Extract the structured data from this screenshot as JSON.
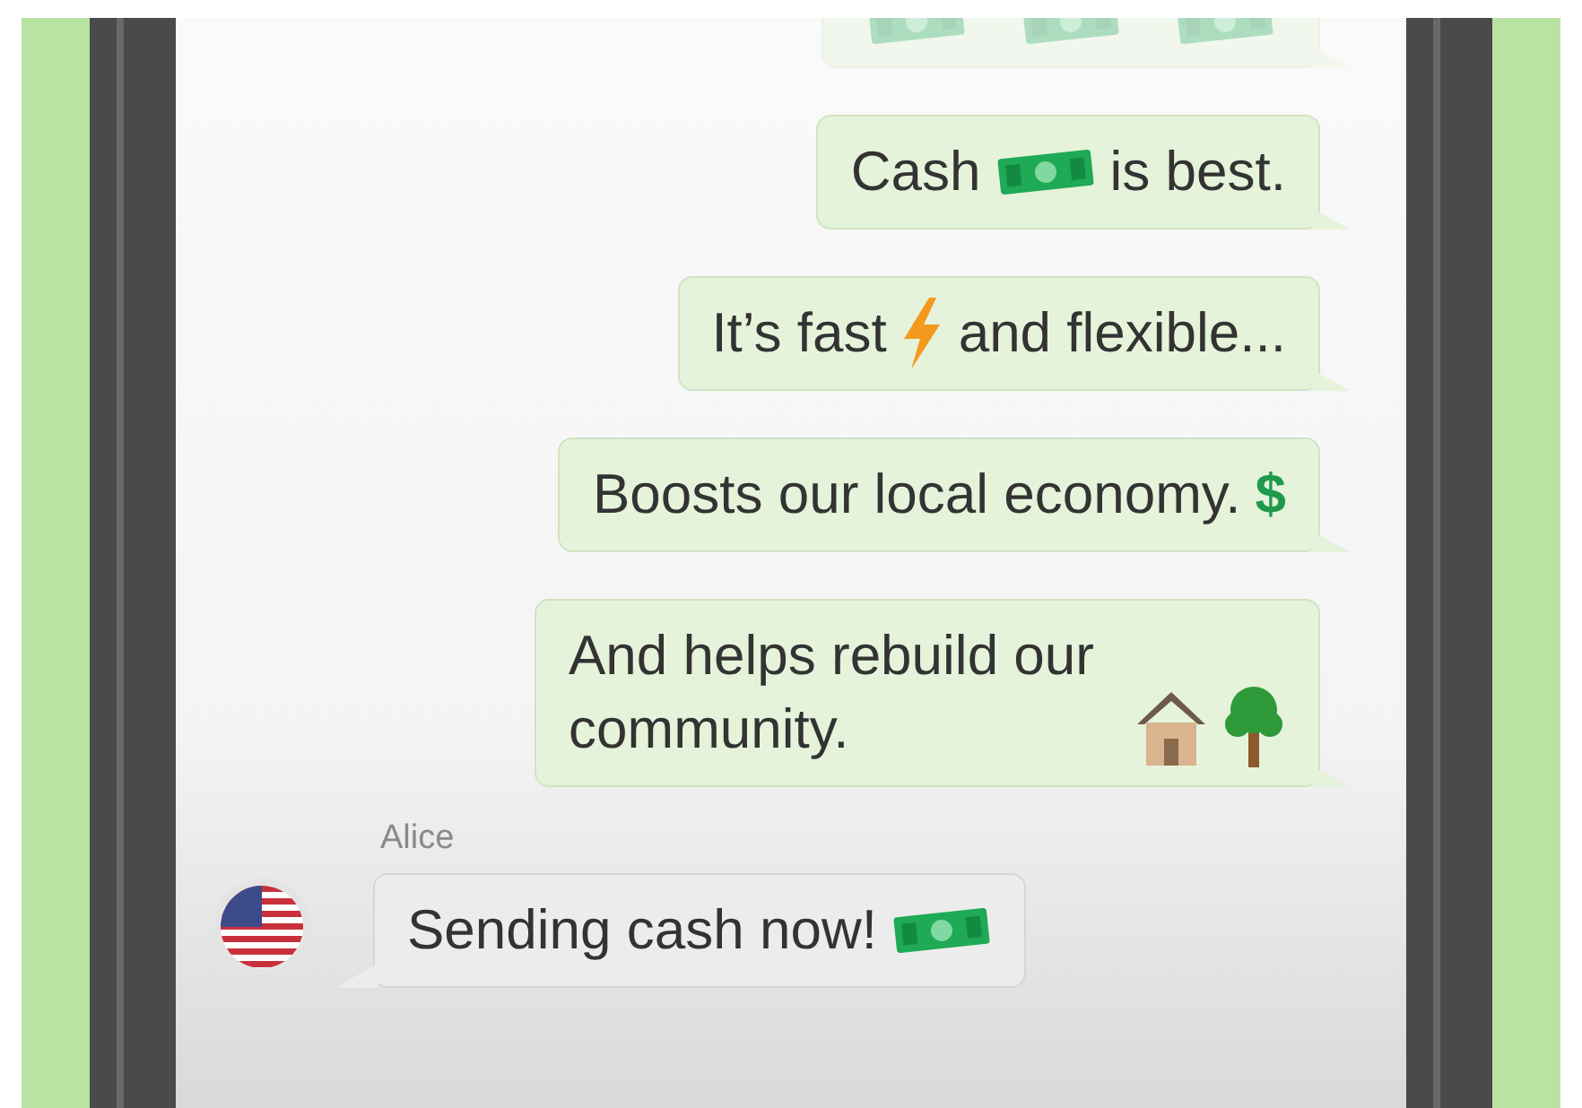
{
  "messages": [
    {
      "incoming": false,
      "faded": true,
      "parts": [
        {
          "kind": "cash"
        },
        {
          "kind": "cash"
        },
        {
          "kind": "cash"
        }
      ]
    },
    {
      "incoming": false,
      "faded": false,
      "parts": [
        {
          "kind": "text",
          "text": "Cash"
        },
        {
          "kind": "cash"
        },
        {
          "kind": "text",
          "text": "is best."
        }
      ]
    },
    {
      "incoming": false,
      "faded": false,
      "parts": [
        {
          "kind": "text",
          "text": "It’s fast"
        },
        {
          "kind": "lightning"
        },
        {
          "kind": "text",
          "text": "and flexible..."
        }
      ]
    },
    {
      "incoming": false,
      "faded": false,
      "parts": [
        {
          "kind": "text",
          "text": "Boosts our local economy."
        },
        {
          "kind": "dollar",
          "text": "$"
        }
      ]
    },
    {
      "incoming": false,
      "faded": false,
      "parts": [
        {
          "kind": "text",
          "text": "And helps rebuild our community."
        },
        {
          "kind": "house"
        },
        {
          "kind": "tree"
        }
      ]
    },
    {
      "incoming": true,
      "faded": false,
      "sender": "Alice",
      "parts": [
        {
          "kind": "text",
          "text": "Sending cash now!"
        },
        {
          "kind": "cash"
        }
      ]
    }
  ]
}
